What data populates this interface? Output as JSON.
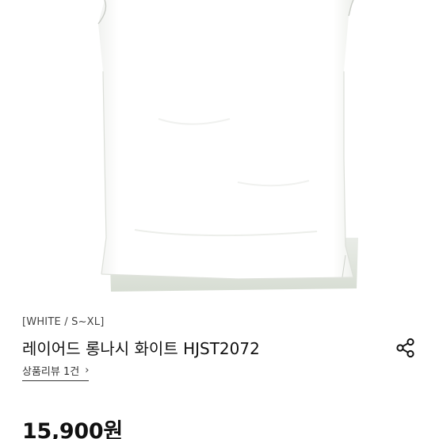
{
  "product": {
    "option_tag": "[WHITE / S~XL]",
    "title": "레이어드 롱나시 화이트 HJST2072",
    "review_link": "상품리뷰 1건",
    "price": "15,900원"
  },
  "icons": {
    "share": "share-icon",
    "review_chevron": "chevron-right-icon"
  },
  "colors": {
    "text_primary": "#111111",
    "text_secondary": "#444444",
    "shirt": "#ffffff",
    "shirt_shadow": "#e2e6e0"
  }
}
